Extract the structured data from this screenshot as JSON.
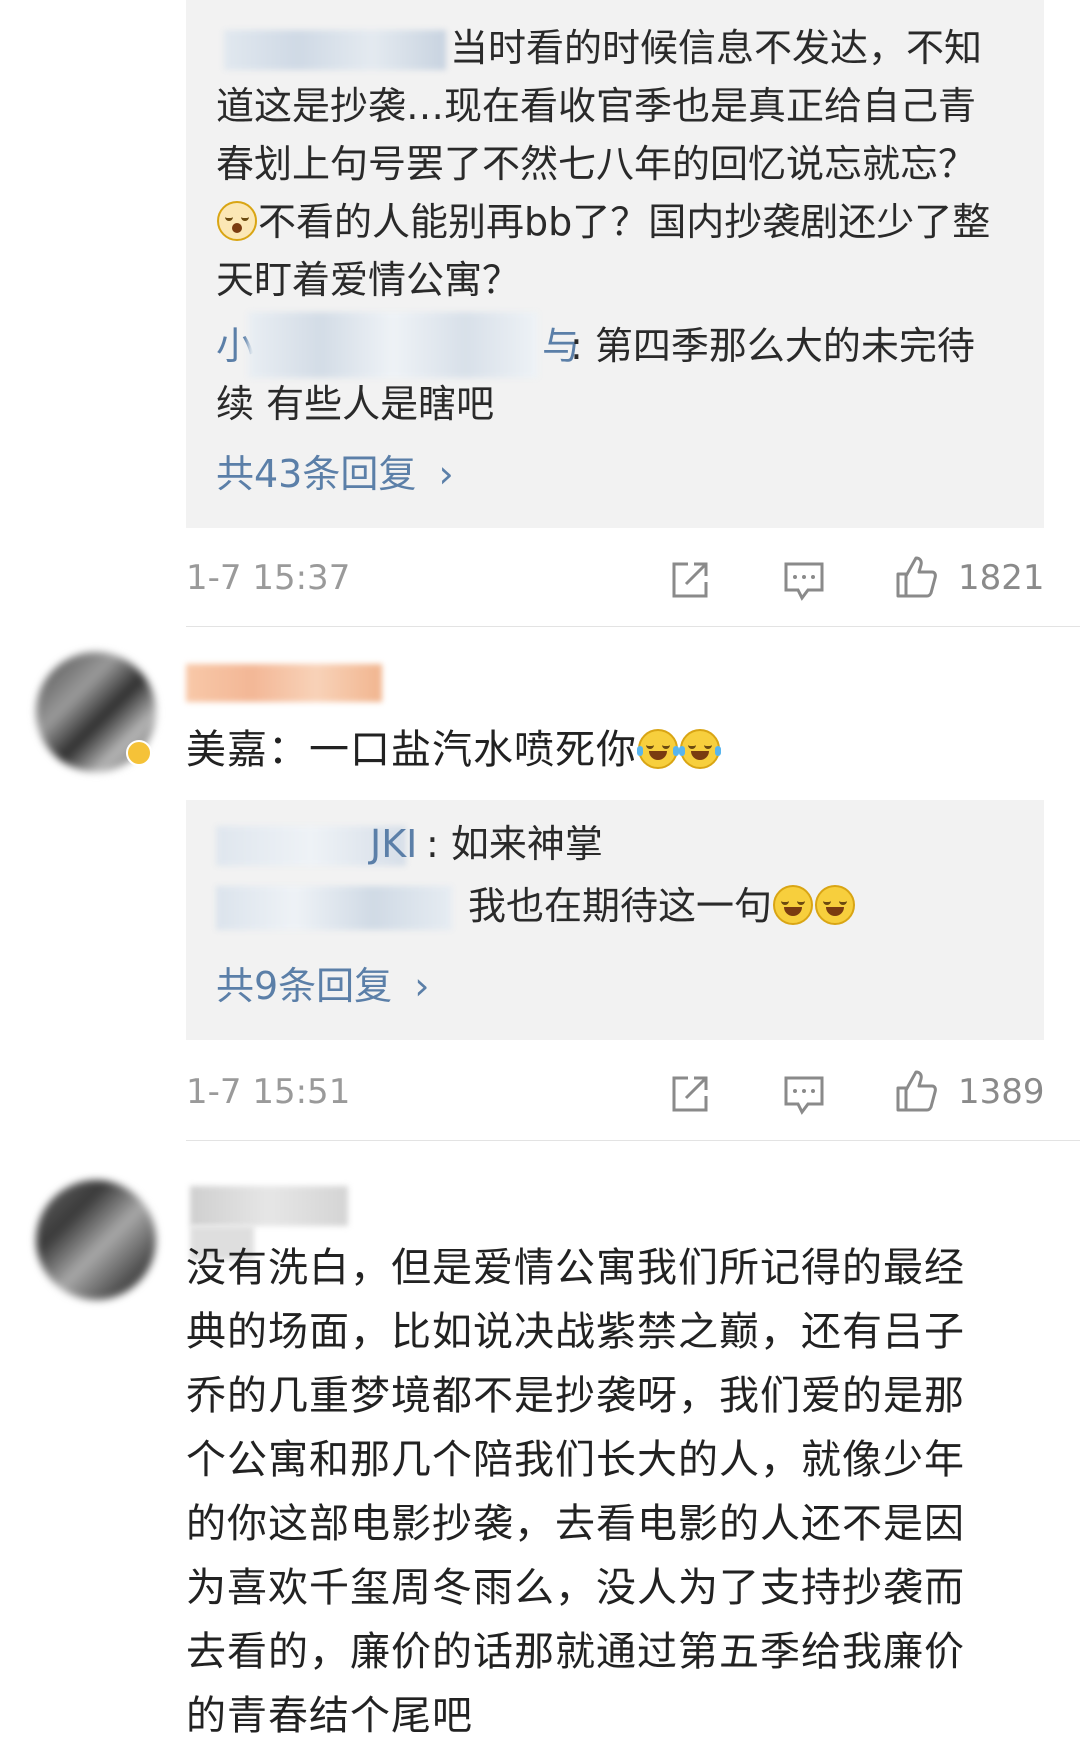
{
  "comment_top": {
    "reply_1_text": "当时看的时候信息不发达，不知道这是抄袭…现在看收官季也是真正给自己青春划上句号罢了不然七八年的回忆说忘就忘？",
    "reply_1_line1": "当时看的时候信息不发达，不知",
    "reply_1_line2": "道这是抄袭…现在看收官季也是真正给自己青",
    "reply_1_line3": "春划上句号罢了不然七八年的回忆说忘就忘？",
    "reply_1_line4": "不看的人能别再bb了？国内抄袭剧还少了整",
    "reply_1_line5": "天盯着爱情公寓？",
    "reply_2_name_visible": "小",
    "reply_2_name_tail": "与",
    "reply_2_line1": ": 第四季那么大的未完待",
    "reply_2_line2": "续 有些人是瞎吧",
    "more_replies": "共43条回复",
    "timestamp": "1-7 15:37",
    "like_count": "1821"
  },
  "comment_mid": {
    "text": "美嘉：一口盐汽水喷死你",
    "reply_1_name_tail": "JKI",
    "reply_1_text": ": 如来神掌",
    "reply_2_text": "我也在期待这一句",
    "more_replies": "共9条回复",
    "timestamp": "1-7 15:51",
    "like_count": "1389"
  },
  "comment_bottom": {
    "line1": "没有洗白，但是爱情公寓我们所记得的最经",
    "line2": "典的场面，比如说决战紫禁之巅，还有吕子",
    "line3": "乔的几重梦境都不是抄袭呀，我们爱的是那",
    "line4": "个公寓和那几个陪我们长大的人，就像少年",
    "line5": "的你这部电影抄袭，去看电影的人还不是因",
    "line6": "为喜欢千玺周冬雨么，没人为了支持抄袭而",
    "line7": "去看的，廉价的话那就通过第五季给我廉价",
    "line8": "的青春结个尾吧"
  },
  "colors": {
    "link": "#5b7fa8",
    "reply_bg": "#f2f2f2",
    "meta": "#9a9a9a"
  },
  "icons": [
    "share-icon",
    "comment-icon",
    "like-icon",
    "laughing-tears-emoji",
    "surprised-emoji"
  ]
}
